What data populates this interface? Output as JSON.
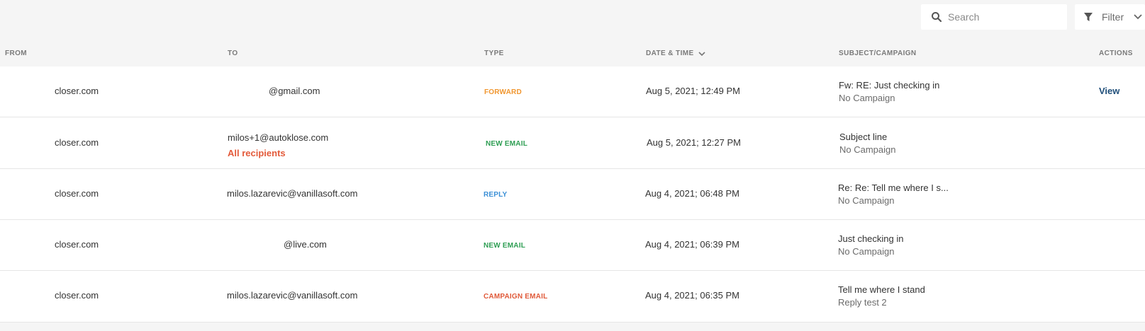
{
  "toolbar": {
    "search_placeholder": "Search",
    "filter_label": "Filter"
  },
  "columns": {
    "from": "FROM",
    "to": "TO",
    "type": "TYPE",
    "datetime": "DATE & TIME",
    "subject": "SUBJECT/CAMPAIGN",
    "actions": "ACTIONS"
  },
  "colors": {
    "forward": "#f0962f",
    "new_email": "#2e9e53",
    "reply": "#3a8fd6",
    "campaign_email": "#e05a3a",
    "all_recipients": "#e35a3a",
    "view_link": "#1f4e79"
  },
  "rows": [
    {
      "from": "closer.com",
      "to": "@gmail.com",
      "type": "FORWARD",
      "datetime": "Aug 5, 2021; 12:49 PM",
      "subject": "Fw: RE: Just checking in",
      "campaign": "No Campaign",
      "action": "View"
    },
    {
      "from": "closer.com",
      "to": "milos+1@autoklose.com",
      "to_extra": "All recipients",
      "type": "NEW EMAIL",
      "datetime": "Aug 5, 2021; 12:27 PM",
      "subject": "Subject line",
      "campaign": "No Campaign"
    },
    {
      "from": "closer.com",
      "to": "milos.lazarevic@vanillasoft.com",
      "type": "REPLY",
      "datetime": "Aug 4, 2021; 06:48 PM",
      "subject": "Re: Re: Tell me where I s...",
      "campaign": "No Campaign"
    },
    {
      "from": "closer.com",
      "to": "@live.com",
      "type": "NEW EMAIL",
      "datetime": "Aug 4, 2021; 06:39 PM",
      "subject": "Just checking in",
      "campaign": "No Campaign"
    },
    {
      "from": "closer.com",
      "to": "milos.lazarevic@vanillasoft.com",
      "type": "CAMPAIGN EMAIL",
      "datetime": "Aug 4, 2021; 06:35 PM",
      "subject": "Tell me where I stand",
      "campaign": "Reply test 2"
    }
  ]
}
